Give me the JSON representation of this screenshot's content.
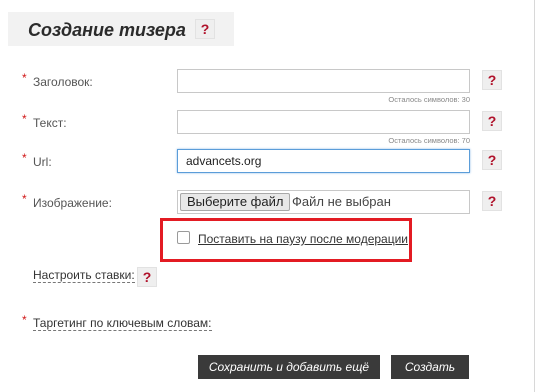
{
  "header": {
    "title": "Создание тизера",
    "help": "?"
  },
  "fields": {
    "title": {
      "label": "Заголовок:",
      "value": "",
      "counter": "Осталось символов: 30",
      "help": "?"
    },
    "text": {
      "label": "Текст:",
      "value": "",
      "counter": "Осталось символов: 70",
      "help": "?"
    },
    "url": {
      "label": "Url:",
      "value": "advancets.org",
      "help": "?"
    },
    "image": {
      "label": "Изображение:",
      "button": "Выберите файл",
      "status": "Файл не выбран",
      "help": "?"
    }
  },
  "required_mark": "*",
  "pause": {
    "label": "Поставить на паузу после модерации",
    "checked": false
  },
  "rates": {
    "label": "Настроить ставки:",
    "help": "?"
  },
  "targeting": {
    "label": "Таргетинг по ключевым словам:"
  },
  "actions": {
    "save_add": "Сохранить и добавить ещё",
    "create": "Создать"
  },
  "colors": {
    "accent_help": "#b0122b",
    "highlight": "#e31b23",
    "button_bg": "#3a3a3a",
    "required": "#d01616"
  }
}
